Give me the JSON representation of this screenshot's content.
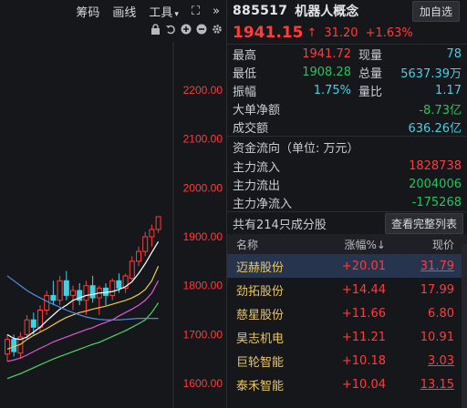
{
  "toolbar": {
    "chips_label": "筹码",
    "draw_label": "画线",
    "tools_label": "工具",
    "tools_caret": "▾",
    "expand_icon": "⛶",
    "more_icon": "»"
  },
  "chart": {
    "y_ticks": [
      "2200.00",
      "2100.00",
      "2000.00",
      "1900.00",
      "1800.00",
      "1700.00",
      "1600.00"
    ],
    "ylim": [
      1580,
      2260
    ],
    "up_color": "#ff3b3b",
    "down_color": "#3fd3e6",
    "ma_colors": [
      "#ffffff",
      "#f2c94c",
      "#e056d5",
      "#4cd964",
      "#4a90e2"
    ]
  },
  "chart_data": {
    "type": "candlestick",
    "ylim": [
      1580,
      2260
    ],
    "y_ticks": [
      2200,
      2100,
      2000,
      1900,
      1800,
      1700,
      1600
    ],
    "candles": [
      {
        "o": 1660,
        "h": 1700,
        "l": 1645,
        "c": 1690
      },
      {
        "o": 1690,
        "h": 1700,
        "l": 1655,
        "c": 1665
      },
      {
        "o": 1662,
        "h": 1705,
        "l": 1650,
        "c": 1695
      },
      {
        "o": 1700,
        "h": 1740,
        "l": 1690,
        "c": 1730
      },
      {
        "o": 1730,
        "h": 1745,
        "l": 1700,
        "c": 1715
      },
      {
        "o": 1715,
        "h": 1760,
        "l": 1705,
        "c": 1750
      },
      {
        "o": 1750,
        "h": 1790,
        "l": 1740,
        "c": 1780
      },
      {
        "o": 1780,
        "h": 1810,
        "l": 1760,
        "c": 1770
      },
      {
        "o": 1770,
        "h": 1820,
        "l": 1760,
        "c": 1810
      },
      {
        "o": 1810,
        "h": 1830,
        "l": 1770,
        "c": 1780
      },
      {
        "o": 1780,
        "h": 1800,
        "l": 1750,
        "c": 1790
      },
      {
        "o": 1790,
        "h": 1805,
        "l": 1760,
        "c": 1770
      },
      {
        "o": 1770,
        "h": 1810,
        "l": 1740,
        "c": 1800
      },
      {
        "o": 1800,
        "h": 1820,
        "l": 1765,
        "c": 1775
      },
      {
        "o": 1775,
        "h": 1800,
        "l": 1740,
        "c": 1795
      },
      {
        "o": 1795,
        "h": 1805,
        "l": 1760,
        "c": 1780
      },
      {
        "o": 1780,
        "h": 1815,
        "l": 1770,
        "c": 1810
      },
      {
        "o": 1810,
        "h": 1825,
        "l": 1785,
        "c": 1795
      },
      {
        "o": 1795,
        "h": 1825,
        "l": 1785,
        "c": 1820
      },
      {
        "o": 1815,
        "h": 1860,
        "l": 1810,
        "c": 1850
      },
      {
        "o": 1850,
        "h": 1880,
        "l": 1840,
        "c": 1870
      },
      {
        "o": 1870,
        "h": 1910,
        "l": 1860,
        "c": 1900
      },
      {
        "o": 1900,
        "h": 1925,
        "l": 1880,
        "c": 1915
      },
      {
        "o": 1915,
        "h": 1942,
        "l": 1908,
        "c": 1941
      }
    ],
    "ma_series": [
      {
        "values": [
          1700,
          1692,
          1690,
          1695,
          1705,
          1715,
          1728,
          1740,
          1752,
          1760,
          1770,
          1775,
          1780,
          1782,
          1785,
          1786,
          1788,
          1792,
          1798,
          1808,
          1825,
          1845,
          1868,
          1890
        ]
      },
      {
        "values": [
          1670,
          1675,
          1680,
          1690,
          1698,
          1705,
          1712,
          1720,
          1728,
          1735,
          1740,
          1745,
          1748,
          1752,
          1755,
          1758,
          1762,
          1766,
          1770,
          1775,
          1782,
          1792,
          1810,
          1840
        ]
      },
      {
        "values": [
          1645,
          1648,
          1652,
          1658,
          1665,
          1672,
          1678,
          1685,
          1690,
          1695,
          1700,
          1705,
          1710,
          1714,
          1720,
          1725,
          1730,
          1738,
          1745,
          1752,
          1760,
          1770,
          1785,
          1810
        ]
      },
      {
        "values": [
          1610,
          1615,
          1620,
          1626,
          1632,
          1638,
          1644,
          1650,
          1655,
          1660,
          1665,
          1670,
          1675,
          1680,
          1684,
          1690,
          1696,
          1702,
          1708,
          1715,
          1722,
          1730,
          1745,
          1765
        ]
      },
      {
        "values": [
          1820,
          1810,
          1800,
          1790,
          1782,
          1775,
          1768,
          1762,
          1756,
          1750,
          1745,
          1740,
          1736,
          1733,
          1731,
          1730,
          1730,
          1730,
          1731,
          1732,
          1733,
          1733,
          1733,
          1733
        ]
      }
    ]
  },
  "header": {
    "code": "885517",
    "name": "机器人概念",
    "add_fav": "加自选"
  },
  "price": {
    "last": "1941.15",
    "arrow": "↑",
    "change": "31.20",
    "pct": "+1.63%"
  },
  "stats": {
    "high_label": "最高",
    "high_value": "1941.72",
    "vol_label": "现量",
    "vol_value": "78",
    "low_label": "最低",
    "low_value": "1908.28",
    "total_label": "总量",
    "total_value": "5637.39万",
    "amp_label": "振幅",
    "amp_value": "1.75%",
    "ratio_label": "量比",
    "ratio_value": "1.17",
    "bignet_label": "大单净额",
    "bignet_value": "-8.73亿",
    "turnover_label": "成交额",
    "turnover_value": "636.26亿"
  },
  "flow": {
    "title": "资金流向（单位: 万元）",
    "in_label": "主力流入",
    "in_value": "1828738",
    "out_label": "主力流出",
    "out_value": "2004006",
    "net_label": "主力净流入",
    "net_value": "-175268"
  },
  "constituents": {
    "summary": "共有214只成分股",
    "view_all": "查看完整列表",
    "col_name": "名称",
    "col_pct": "涨幅%↓",
    "col_price": "现价",
    "rows": [
      {
        "name": "迈赫股份",
        "pct": "+20.01",
        "price": "31.79"
      },
      {
        "name": "劲拓股份",
        "pct": "+14.44",
        "price": "17.99"
      },
      {
        "name": "慈星股份",
        "pct": "+11.66",
        "price": "6.80"
      },
      {
        "name": "昊志机电",
        "pct": "+11.21",
        "price": "10.91"
      },
      {
        "name": "巨轮智能",
        "pct": "+10.18",
        "price": "3.03"
      },
      {
        "name": "泰禾智能",
        "pct": "+10.04",
        "price": "13.15"
      }
    ]
  }
}
